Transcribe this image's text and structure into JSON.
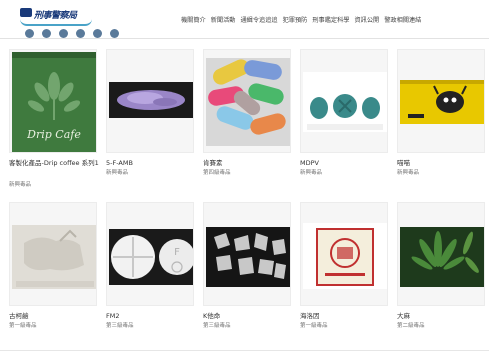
{
  "site": {
    "logo_text": "刑事警察局"
  },
  "nav": {
    "items": [
      "機關簡介",
      "新聞活動",
      "通緝令追追追",
      "犯罪預防",
      "刑事鑑定科學",
      "資訊公開",
      "警政相關連結"
    ]
  },
  "products": [
    {
      "title": "客製化產品-Drip coffee 系列1",
      "category": "新興毒品",
      "image_text": "Drip Cafe",
      "image": "green-coffee-bag"
    },
    {
      "title": "5-F-AMB",
      "category": "新興毒品",
      "image": "purple-crystals"
    },
    {
      "title": "肯賽素",
      "category": "第四級毒品",
      "image": "colorful-capsules"
    },
    {
      "title": "MDPV",
      "category": "新興毒品",
      "image": "teal-tablets"
    },
    {
      "title": "喵喵",
      "category": "新興毒品",
      "image": "yellow-packet"
    },
    {
      "title": "古柯鹼",
      "category": "第一級毒品",
      "image": "white-block"
    },
    {
      "title": "FM2",
      "category": "第三級毒品",
      "image": "white-tablets"
    },
    {
      "title": "K他命",
      "category": "第三級毒品",
      "image": "clear-crystals"
    },
    {
      "title": "海洛因",
      "category": "第一級毒品",
      "image": "heroin-package"
    },
    {
      "title": "大麻",
      "category": "第二級毒品",
      "image": "cannabis-leaves"
    }
  ]
}
